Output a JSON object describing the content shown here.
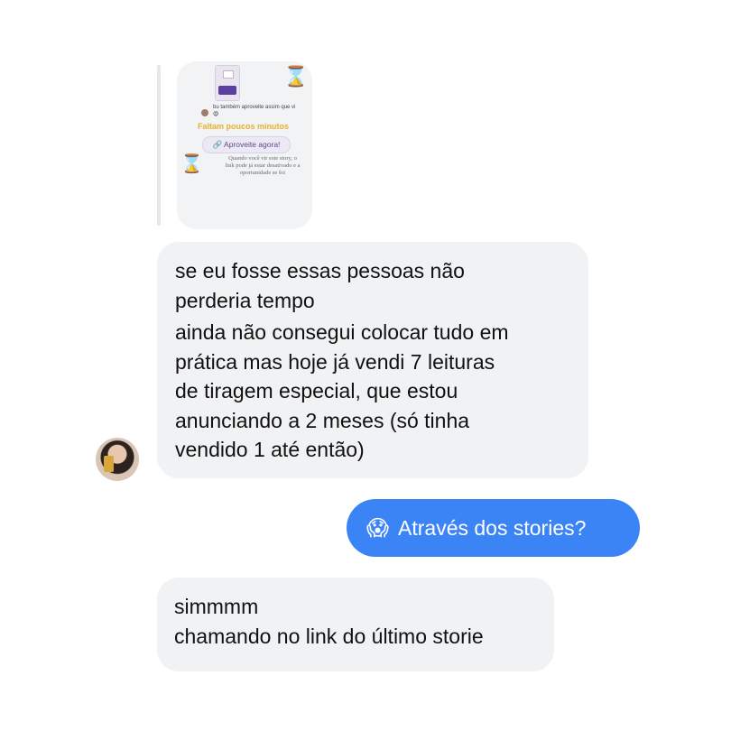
{
  "story_reply": {
    "caption": "bu também aproveite assim que vi",
    "caption_emoji": "😍",
    "urgent_text": "Faltam poucos minutos",
    "button_label": "🔗 Aproveite agora!",
    "note": "Quando você vir este story, o link pode já estar desativado e a oportunidade se foi",
    "hourglass_icon": "⌛"
  },
  "messages": [
    {
      "sender": "other",
      "lines": [
        "se eu fosse essas pessoas não",
        "perderia tempo",
        "ainda não consegui colocar tudo em",
        "prática mas hoje já vendi 7 leituras",
        "de tiragem especial, que estou",
        "anunciando a 2 meses (só tinha",
        "vendido 1 até então)"
      ]
    },
    {
      "sender": "me",
      "emoji": "😱",
      "text": "Através dos stories?"
    },
    {
      "sender": "other",
      "lines": [
        "simmmm",
        "chamando no link do último storie"
      ]
    }
  ],
  "colors": {
    "incoming_bubble": "#f1f2f4",
    "outgoing_bubble": "#3b84f6",
    "urgent_text": "#e6b22e"
  }
}
